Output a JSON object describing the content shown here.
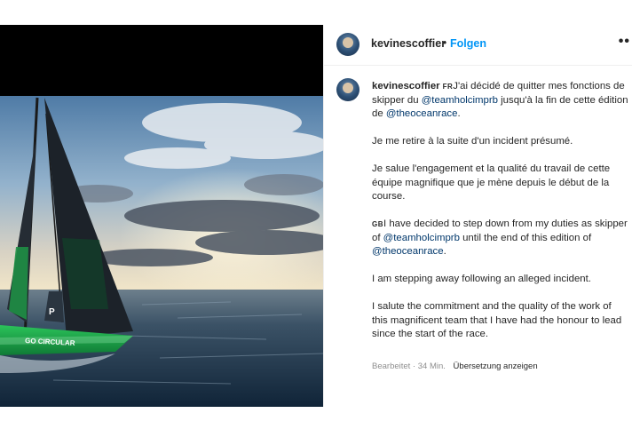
{
  "header": {
    "username": "kevinescoffier",
    "separator": "•",
    "follow_label": "Folgen",
    "more_label": "••"
  },
  "caption": {
    "username": "kevinescoffier",
    "fr_flag": "FR",
    "fr_p1_a": "J'ai décidé de quitter mes fonctions de skipper du ",
    "fr_p1_mention1": "@teamholcimprb",
    "fr_p1_b": " jusqu'à la fin de cette édition de ",
    "fr_p1_mention2": "@theoceanrace",
    "fr_p1_c": ".",
    "fr_p2": "Je me retire à la suite d'un incident présumé.",
    "fr_p3": "Je salue l'engagement et la qualité du travail de cette équipe magnifique que je mène depuis le début de la course.",
    "gb_flag": "GB",
    "en_p1_a": "I have decided to step down from my duties as skipper of ",
    "en_p1_mention1": "@teamholcimprb",
    "en_p1_b": " until the end of this edition of ",
    "en_p1_mention2": "@theoceanrace",
    "en_p1_c": ".",
    "en_p2": "I am stepping away following an alleged incident.",
    "en_p3": "I salute the commitment and the quality of the work of this magnificent team that I have had the honour to lead since the start of the race."
  },
  "meta": {
    "edited": "Bearbeitet · 34 Min.",
    "translate_label": "Übersetzung anzeigen"
  },
  "photo": {
    "hull_text": "GO CIRCULAR",
    "sail_mark": "P",
    "hull_color": "#1fa34a"
  }
}
